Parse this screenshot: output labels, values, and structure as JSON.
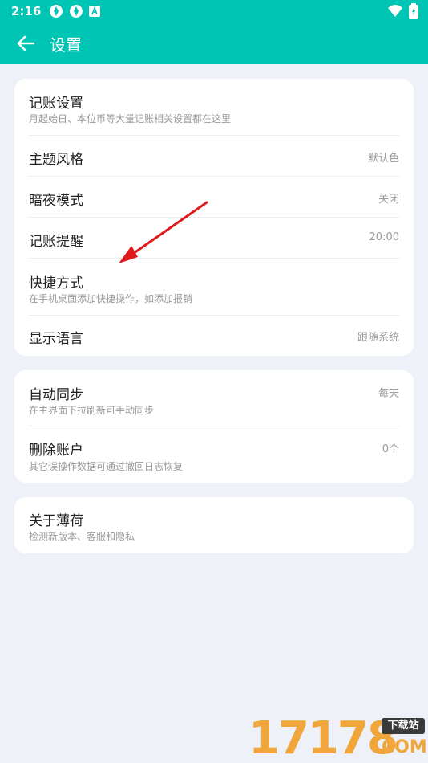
{
  "status": {
    "time": "2:16"
  },
  "header": {
    "title": "设置"
  },
  "group1": [
    {
      "title": "记账设置",
      "subtitle": "月起始日、本位币等大量记账相关设置都在这里",
      "value": ""
    },
    {
      "title": "主题风格",
      "subtitle": "",
      "value": "默认色"
    },
    {
      "title": "暗夜模式",
      "subtitle": "",
      "value": "关闭"
    },
    {
      "title": "记账提醒",
      "subtitle": "",
      "value": "20:00"
    },
    {
      "title": "快捷方式",
      "subtitle": "在手机桌面添加快捷操作，如添加报销",
      "value": ""
    },
    {
      "title": "显示语言",
      "subtitle": "",
      "value": "跟随系统"
    }
  ],
  "group2": [
    {
      "title": "自动同步",
      "subtitle": "在主界面下拉刷新可手动同步",
      "value": "每天"
    },
    {
      "title": "删除账户",
      "subtitle": "其它误操作数据可通过撤回日志恢复",
      "value": "0个"
    }
  ],
  "group3": [
    {
      "title": "关于薄荷",
      "subtitle": "检测新版本、客服和隐私",
      "value": ""
    }
  ],
  "watermark": {
    "digits": "17178",
    "badge": "下载站",
    "domain": "COM"
  },
  "colors": {
    "accent": "#00c4b4",
    "background": "#eef1f7",
    "arrow": "#e01a1a",
    "watermark": "#f0a63a"
  }
}
